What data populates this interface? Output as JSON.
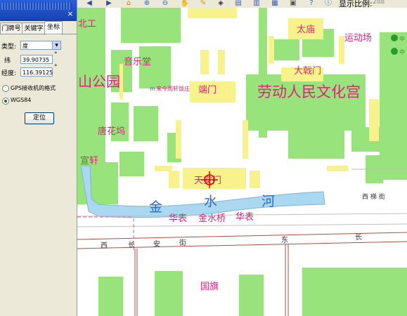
{
  "toolbar": {
    "icons": [
      "arrow-left-icon",
      "arrow-right-icon",
      "home-icon",
      "zoom-in-icon",
      "zoom-out-icon",
      "pan-hand-icon",
      "measure-icon",
      "layers-icon",
      "document-icon",
      "chart-icon",
      "grid-icon",
      "print-icon",
      "help-icon",
      "info-icon"
    ],
    "scale_label": "显示比例:",
    "scale_value": "288"
  },
  "panel": {
    "close_glyph": "×",
    "tabs": [
      "门牌号",
      "关键字",
      "坐标"
    ],
    "active_tab": 2,
    "type_label": "类型:",
    "type_value": "度",
    "lat_label": "纬",
    "lat_value": "39.90735",
    "lon_label": "经度:",
    "lon_value": "116.39125",
    "degree_mark": "°",
    "radio_gps": "GPS接收机的格式",
    "radio_wgs": "WGS84",
    "selected_radio": "WGS84",
    "locate_button": "定位"
  },
  "map": {
    "labels": {
      "zhongshan_park": "山公园",
      "concert_hall": "音乐堂",
      "laitinxuan": "来今雨轩饭庄",
      "duanmen": "端门",
      "taimiao": "太庙",
      "sports_field": "运动场",
      "dajimen": "大戟门",
      "cultural_palace": "劳动人民文化宫",
      "tanghuawu": "唐花坞",
      "xuan": "宣轩",
      "tiananmen": "天安门",
      "river_jin": "金",
      "river_shui": "水",
      "river_he": "河",
      "huabiao_1": "华表",
      "jinshuiqiao": "金水桥",
      "huabiao_2": "华表",
      "xi": "西",
      "chang": "长",
      "an": "安",
      "jie": "街",
      "dong": "东",
      "chang_2": "长",
      "guoqi": "国旗",
      "xilinjie": "西 梯 街",
      "top_left_fragment": "北工",
      "poi_badge_1": "中",
      "poi_badge_2": "中"
    },
    "colors": {
      "park": "#99e37d",
      "building": "#f7f28b",
      "river": "#a9d8f0",
      "label": "#e0237a",
      "road_line": "#a85040",
      "marker": "#e00000"
    }
  }
}
